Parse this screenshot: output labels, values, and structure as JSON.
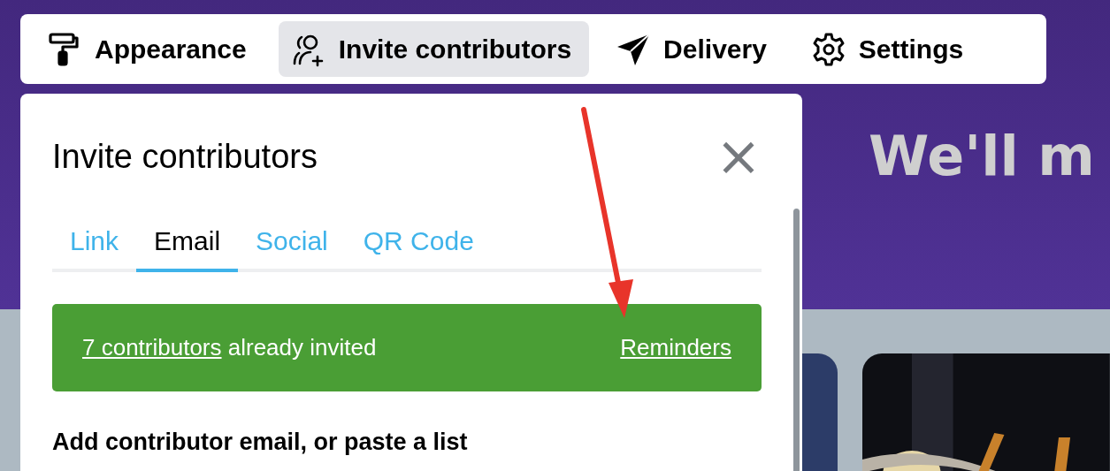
{
  "toolbar": [
    {
      "label": "Appearance",
      "selected": false
    },
    {
      "label": "Invite contributors",
      "selected": true
    },
    {
      "label": "Delivery",
      "selected": false
    },
    {
      "label": "Settings",
      "selected": false
    }
  ],
  "hero": {
    "heading": "We'll m"
  },
  "panel": {
    "title": "Invite contributors",
    "close": "×",
    "tabs": [
      {
        "label": "Link",
        "selected": false
      },
      {
        "label": "Email",
        "selected": true
      },
      {
        "label": "Social",
        "selected": false
      },
      {
        "label": "QR Code",
        "selected": false
      }
    ],
    "banner": {
      "link": "7 contributors",
      "text": "already invited",
      "reminders": "Reminders"
    },
    "field_label": "Add contributor email, or paste a list"
  }
}
